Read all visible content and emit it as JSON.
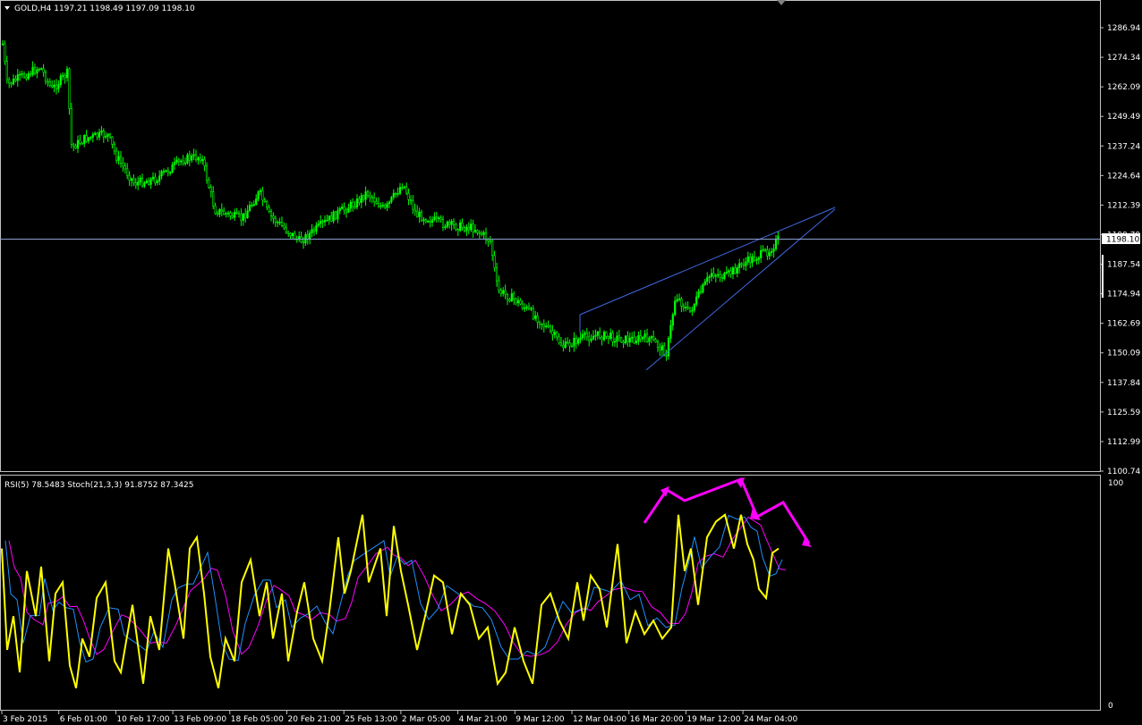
{
  "main_panel": {
    "header": "GOLD,H4  1197.21 1198.49 1197.09 1198.10",
    "price_ticks": [
      "1286.94",
      "1274.34",
      "1262.09",
      "1249.49",
      "1237.24",
      "1224.64",
      "1212.39",
      "1199.79",
      "1187.54",
      "1174.94",
      "1162.69",
      "1150.09",
      "1137.84",
      "1125.59",
      "1112.99",
      "1100.74"
    ],
    "current_price_label": "1198.10",
    "colors": {
      "background": "#000000",
      "candles": "#00ff00",
      "grid_frame": "#c0c0c0",
      "trendlines": "#4169e1",
      "price_line": "#8ca0d0",
      "price_label_bg": "#ffffff",
      "price_label_text": "#000000"
    }
  },
  "sub_panel": {
    "header": "RSI(5) 78.5483  Stoch(21,3,3) 91.8752 87.3425",
    "top_tick": "100",
    "bottom_tick": "0",
    "colors": {
      "rsi": "#ffff00",
      "stoch_main": "#1e90ff",
      "stoch_signal": "#ff00ff",
      "annotations": "#ff00ff"
    }
  },
  "time_axis": [
    "3 Feb 2015",
    "6 Feb 01:00",
    "10 Feb 17:00",
    "13 Feb 09:00",
    "18 Feb 05:00",
    "20 Feb 21:00",
    "25 Feb 13:00",
    "2 Mar 05:00",
    "4 Mar 21:00",
    "9 Mar 12:00",
    "12 Mar 04:00",
    "16 Mar 20:00",
    "19 Mar 12:00",
    "24 Mar 04:00"
  ]
}
